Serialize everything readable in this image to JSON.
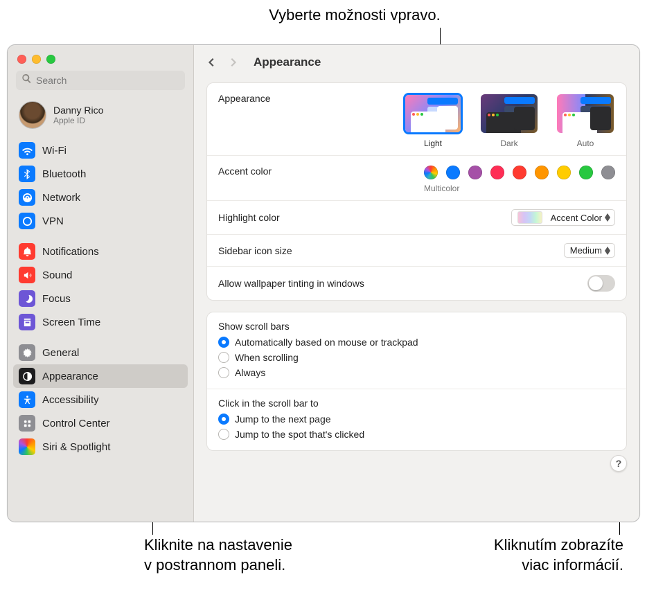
{
  "callouts": {
    "top": "Vyberte možnosti vpravo.",
    "bottom_left_l1": "Kliknite na nastavenie",
    "bottom_left_l2": "v postrannom paneli.",
    "bottom_right_l1": "Kliknutím zobrazíte",
    "bottom_right_l2": "viac informácií."
  },
  "search": {
    "placeholder": "Search"
  },
  "user": {
    "name": "Danny Rico",
    "sub": "Apple ID"
  },
  "sidebar": {
    "g1": [
      {
        "label": "Wi-Fi"
      },
      {
        "label": "Bluetooth"
      },
      {
        "label": "Network"
      },
      {
        "label": "VPN"
      }
    ],
    "g2": [
      {
        "label": "Notifications"
      },
      {
        "label": "Sound"
      },
      {
        "label": "Focus"
      },
      {
        "label": "Screen Time"
      }
    ],
    "g3": [
      {
        "label": "General"
      },
      {
        "label": "Appearance"
      },
      {
        "label": "Accessibility"
      },
      {
        "label": "Control Center"
      },
      {
        "label": "Siri & Spotlight"
      }
    ]
  },
  "page_title": "Appearance",
  "appearance": {
    "label": "Appearance",
    "options": {
      "light": "Light",
      "dark": "Dark",
      "auto": "Auto"
    }
  },
  "accent": {
    "label": "Accent color",
    "selected_name": "Multicolor",
    "colors": [
      "#0a7aff",
      "#a550a7",
      "#ff2d55",
      "#ff3b30",
      "#ff9500",
      "#ffcc00",
      "#28c840",
      "#8e8e93"
    ]
  },
  "highlight": {
    "label": "Highlight color",
    "value": "Accent Color"
  },
  "sidebar_size": {
    "label": "Sidebar icon size",
    "value": "Medium"
  },
  "tinting": {
    "label": "Allow wallpaper tinting in windows"
  },
  "scrollbars": {
    "title": "Show scroll bars",
    "opts": [
      "Automatically based on mouse or trackpad",
      "When scrolling",
      "Always"
    ]
  },
  "click_scroll": {
    "title": "Click in the scroll bar to",
    "opts": [
      "Jump to the next page",
      "Jump to the spot that's clicked"
    ]
  },
  "help": "?"
}
